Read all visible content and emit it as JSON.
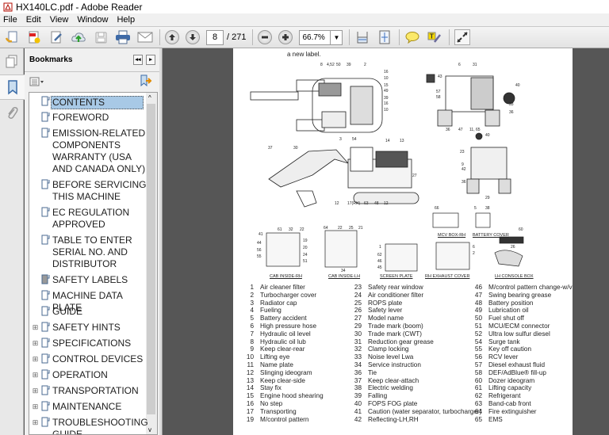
{
  "window": {
    "title": "HX140LC.pdf - Adobe Reader"
  },
  "menu": [
    "File",
    "Edit",
    "View",
    "Window",
    "Help"
  ],
  "toolbar": {
    "current_page": "8",
    "total_pages": "/ 271",
    "zoom": "66.7%"
  },
  "panel": {
    "title": "Bookmarks",
    "bookmarks": [
      {
        "label": "CONTENTS",
        "selected": true,
        "expandable": false
      },
      {
        "label": "FOREWORD",
        "expandable": false
      },
      {
        "label": "EMISSION-RELATED COMPONENTS WARRANTY (USA AND CANADA ONLY)",
        "expandable": false
      },
      {
        "label": "BEFORE SERVICING THIS MACHINE",
        "expandable": false
      },
      {
        "label": "EC REGULATION APPROVED",
        "expandable": false
      },
      {
        "label": "TABLE TO ENTER SERIAL NO. AND DISTRIBUTOR",
        "expandable": false
      },
      {
        "label": "SAFETY LABELS",
        "expandable": false
      },
      {
        "label": "MACHINE DATA PLATE",
        "expandable": false
      },
      {
        "label": "GUIDE",
        "expandable": false
      },
      {
        "label": "SAFETY HINTS",
        "expandable": true
      },
      {
        "label": "SPECIFICATIONS",
        "expandable": true
      },
      {
        "label": "CONTROL DEVICES",
        "expandable": true
      },
      {
        "label": "OPERATION",
        "expandable": true
      },
      {
        "label": "TRANSPORTATION",
        "expandable": true
      },
      {
        "label": "MAINTENANCE",
        "expandable": true
      },
      {
        "label": "TROUBLESHOOTING GUIDE",
        "expandable": true
      }
    ]
  },
  "document": {
    "intro_text": "a new label.",
    "figure_captions": {
      "mcv_box": "MCV BOX-RH",
      "battery_cover": "BATTERY COVER",
      "cab_inside_rh": "CAB INSIDE-RH",
      "cab_inside_lh": "CAB INSIDE-LH",
      "screen_plate": "SCREEN PLATE",
      "rh_exhaust_cover": "RH EXHAUST COVER",
      "lh_console_box": "LH CONSOLE BOX"
    },
    "callouts": {
      "top_view": [
        "8",
        "4,52",
        "50",
        "39",
        "2",
        "16",
        "10",
        "15",
        "49",
        "39",
        "16",
        "10",
        "3",
        "54"
      ],
      "rear_view": [
        "43",
        "6",
        "31",
        "57",
        "58",
        "40",
        "33",
        "36",
        "36",
        "47",
        "11, 65"
      ],
      "side_view": [
        "37",
        "30",
        "14",
        "13",
        "27",
        "12",
        "17(RH)",
        "63",
        "48",
        "12"
      ],
      "front_view": [
        "40",
        "23",
        "9",
        "42",
        "36",
        "29"
      ],
      "mcv": [
        "66"
      ],
      "battery": [
        "5",
        "38"
      ],
      "cab_rh": [
        "41",
        "61",
        "32",
        "22",
        "44",
        "19",
        "56",
        "20",
        "55",
        "24",
        "51"
      ],
      "cab_lh": [
        "64",
        "22",
        "25",
        "21",
        "34"
      ],
      "screen": [
        "1",
        "62",
        "46",
        "45"
      ],
      "exhaust": [
        "6",
        "2"
      ],
      "console": [
        "60",
        "26"
      ]
    },
    "label_list": {
      "col1": [
        {
          "n": "1",
          "t": "Air cleaner filter"
        },
        {
          "n": "2",
          "t": "Turbocharger cover"
        },
        {
          "n": "3",
          "t": "Radiator cap"
        },
        {
          "n": "4",
          "t": "Fueling"
        },
        {
          "n": "5",
          "t": "Battery accident"
        },
        {
          "n": "6",
          "t": "High pressure hose"
        },
        {
          "n": "7",
          "t": "Hydraulic oil level"
        },
        {
          "n": "8",
          "t": "Hydraulic oil lub"
        },
        {
          "n": "9",
          "t": "Keep clear-rear"
        },
        {
          "n": "10",
          "t": "Lifting eye"
        },
        {
          "n": "11",
          "t": "Name plate"
        },
        {
          "n": "12",
          "t": "Slinging ideogram"
        },
        {
          "n": "13",
          "t": "Keep clear-side"
        },
        {
          "n": "14",
          "t": "Stay fix"
        },
        {
          "n": "15",
          "t": "Engine hood shearing"
        },
        {
          "n": "16",
          "t": "No step"
        },
        {
          "n": "17",
          "t": "Transporting"
        },
        {
          "n": "19",
          "t": "M/control pattern"
        }
      ],
      "col2": [
        {
          "n": "23",
          "t": "Safety rear window"
        },
        {
          "n": "24",
          "t": "Air conditioner filter"
        },
        {
          "n": "25",
          "t": "ROPS plate"
        },
        {
          "n": "26",
          "t": "Safety lever"
        },
        {
          "n": "27",
          "t": "Model name"
        },
        {
          "n": "29",
          "t": "Trade mark (boom)"
        },
        {
          "n": "30",
          "t": "Trade mark (CWT)"
        },
        {
          "n": "31",
          "t": "Reduction gear grease"
        },
        {
          "n": "32",
          "t": "Clamp locking"
        },
        {
          "n": "33",
          "t": "Noise level Lwa"
        },
        {
          "n": "34",
          "t": "Service instruction"
        },
        {
          "n": "36",
          "t": "Tie"
        },
        {
          "n": "37",
          "t": "Keep clear-attach"
        },
        {
          "n": "38",
          "t": "Electric welding"
        },
        {
          "n": "39",
          "t": "Falling"
        },
        {
          "n": "40",
          "t": "FOPS FOG plate"
        },
        {
          "n": "41",
          "t": "Caution (water separator, turbocharger)"
        },
        {
          "n": "42",
          "t": "Reflecting-LH,RH"
        }
      ],
      "col3": [
        {
          "n": "46",
          "t": "M/control pattern change-w/valve"
        },
        {
          "n": "47",
          "t": "Swing bearing grease"
        },
        {
          "n": "48",
          "t": "Battery position"
        },
        {
          "n": "49",
          "t": "Lubrication oil"
        },
        {
          "n": "50",
          "t": "Fuel shut off"
        },
        {
          "n": "51",
          "t": "MCU/ECM connector"
        },
        {
          "n": "52",
          "t": "Ultra low sulfur diesel"
        },
        {
          "n": "54",
          "t": "Surge tank"
        },
        {
          "n": "55",
          "t": "Key off caution"
        },
        {
          "n": "56",
          "t": "RCV lever"
        },
        {
          "n": "57",
          "t": "Diesel exhaust fluid"
        },
        {
          "n": "58",
          "t": "DEF/AdBlue® fill-up"
        },
        {
          "n": "60",
          "t": "Dozer ideogram"
        },
        {
          "n": "61",
          "t": "Lifting capacity"
        },
        {
          "n": "62",
          "t": "Refrigerant"
        },
        {
          "n": "63",
          "t": "Band-cab front"
        },
        {
          "n": "64",
          "t": "Fire extinguisher"
        },
        {
          "n": "65",
          "t": "EMS"
        }
      ]
    }
  }
}
